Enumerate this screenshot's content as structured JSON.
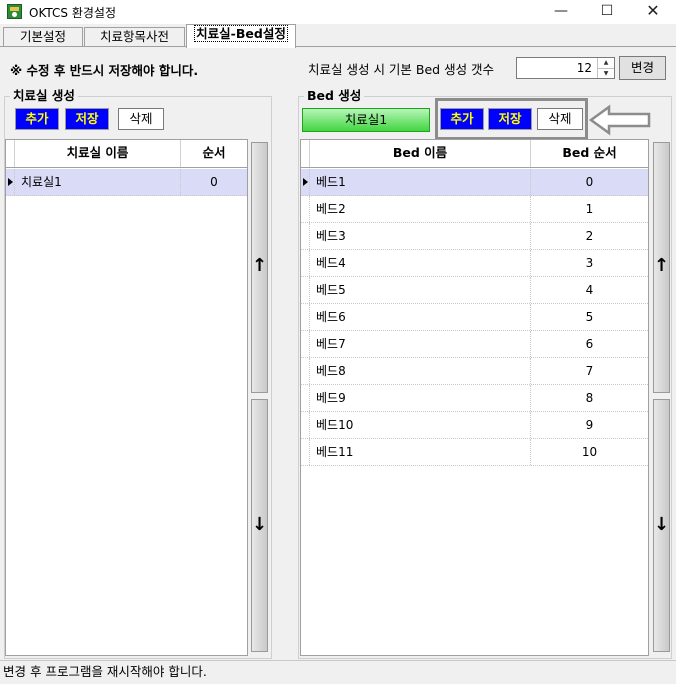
{
  "window": {
    "title": "OKTCS 환경설정",
    "icon": "app-icon",
    "controls": {
      "minimize": "—",
      "maximize": "☐",
      "close": "✕"
    }
  },
  "tabs": [
    {
      "label": "기본설정",
      "active": false
    },
    {
      "label": "치료항목사전",
      "active": false
    },
    {
      "label": "치료실-Bed설정",
      "active": true
    }
  ],
  "notice": "※ 수정 후 반드시 저장해야 합니다.",
  "bed_default": {
    "label": "치료실 생성 시 기본 Bed 생성 갯수",
    "value": "12",
    "change_label": "변경"
  },
  "room_group": {
    "title": "치료실 생성",
    "add_label": "추가",
    "save_label": "저장",
    "delete_label": "삭제",
    "columns": [
      "치료실 이름",
      "순서"
    ],
    "rows": [
      {
        "name": "치료실1",
        "order": "0",
        "selected": true
      }
    ],
    "up_icon": "↑",
    "down_icon": "↓"
  },
  "bed_group": {
    "title": "Bed 생성",
    "room_button_label": "치료실1",
    "add_label": "추가",
    "save_label": "저장",
    "delete_label": "삭제",
    "columns": [
      "Bed 이름",
      "Bed 순서"
    ],
    "rows": [
      {
        "name": "베드1",
        "order": "0",
        "selected": true
      },
      {
        "name": "베드2",
        "order": "1"
      },
      {
        "name": "베드3",
        "order": "2"
      },
      {
        "name": "베드4",
        "order": "3"
      },
      {
        "name": "베드5",
        "order": "4"
      },
      {
        "name": "베드6",
        "order": "5"
      },
      {
        "name": "베드7",
        "order": "6"
      },
      {
        "name": "베드8",
        "order": "7"
      },
      {
        "name": "베드9",
        "order": "8"
      },
      {
        "name": "베드10",
        "order": "9"
      },
      {
        "name": "베드11",
        "order": "10"
      }
    ],
    "up_icon": "↑",
    "down_icon": "↓"
  },
  "colors": {
    "selected_row": "#dadbf6",
    "blue_button": "#0000ff",
    "blue_button_text": "#ffff00",
    "green_button": "#42d642"
  },
  "status": "변경 후 프로그램을 재시작해야 합니다."
}
